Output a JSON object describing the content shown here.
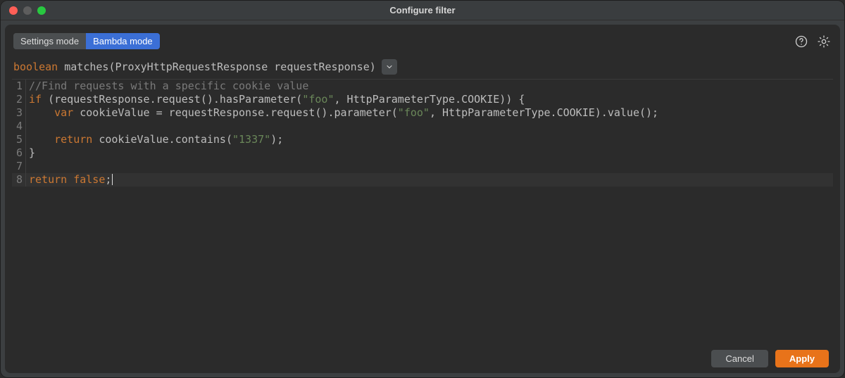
{
  "window": {
    "title": "Configure filter"
  },
  "modes": {
    "settings": "Settings mode",
    "bambda": "Bambda mode",
    "active": "bambda"
  },
  "signature": {
    "ret": "boolean",
    "name": "matches",
    "open": "(",
    "paramType": "ProxyHttpRequestResponse",
    "paramName": "requestResponse",
    "close": ")"
  },
  "code": {
    "line1_comment": "//Find requests with a specific cookie value",
    "line2_kw": "if",
    "line2_rest": " (requestResponse.request().hasParameter(",
    "line2_str": "\"foo\"",
    "line2_mid": ", HttpParameterType.COOKIE)) {",
    "line3_ind": "    ",
    "line3_kw": "var",
    "line3_rest": " cookieValue = requestResponse.request().parameter(",
    "line3_str": "\"foo\"",
    "line3_mid": ", HttpParameterType.COOKIE).value();",
    "line4": "",
    "line5_ind": "    ",
    "line5_kw": "return",
    "line5_rest": " cookieValue.contains(",
    "line5_str": "\"1337\"",
    "line5_end": ");",
    "line6": "}",
    "line7": "",
    "line8_kw": "return",
    "line8_sp": " ",
    "line8_kw2": "false",
    "line8_end": ";",
    "gutters": {
      "l1": "1",
      "l2": "2",
      "l3": "3",
      "l4": "4",
      "l5": "5",
      "l6": "6",
      "l7": "7",
      "l8": "8"
    }
  },
  "buttons": {
    "cancel": "Cancel",
    "apply": "Apply"
  }
}
